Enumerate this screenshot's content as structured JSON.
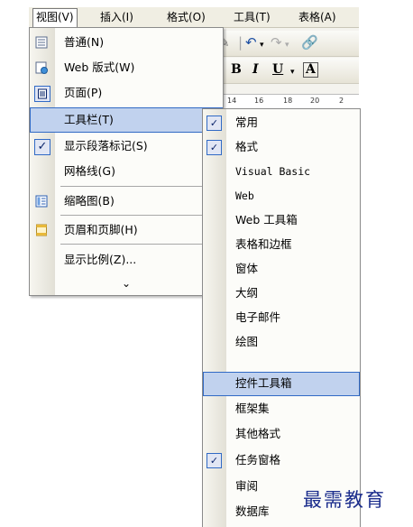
{
  "menubar": {
    "items": [
      {
        "label": "视图(V)",
        "active": true
      },
      {
        "label": "插入(I)"
      },
      {
        "label": "格式(O)"
      },
      {
        "label": "工具(T)"
      },
      {
        "label": "表格(A)"
      }
    ]
  },
  "toolbar": {
    "bold": "B",
    "italic": "I",
    "underline": "U",
    "font_color": "A",
    "ruler_ticks": [
      "14",
      "16",
      "18",
      "20",
      "2"
    ]
  },
  "view_menu": {
    "items": [
      {
        "label": "普通(N)",
        "icon": "normal-view-icon"
      },
      {
        "label": "Web 版式(W)",
        "icon": "web-layout-icon"
      },
      {
        "label": "页面(P)",
        "icon": "page-layout-icon"
      },
      {
        "label": "工具栏(T)",
        "submenu_arrow": "▶"
      },
      {
        "label": "显示段落标记(S)",
        "checked": true
      },
      {
        "label": "网格线(G)"
      },
      {
        "label": "缩略图(B)",
        "icon": "thumbnail-icon"
      },
      {
        "label": "页眉和页脚(H)",
        "icon": "header-footer-icon"
      },
      {
        "label": "显示比例(Z)..."
      }
    ],
    "more_glyph": "⌄"
  },
  "toolbars_submenu": {
    "items": [
      {
        "label": "常用",
        "checked": true
      },
      {
        "label": "格式",
        "checked": true
      },
      {
        "label": "Visual Basic"
      },
      {
        "label": "Web"
      },
      {
        "label": "Web 工具箱"
      },
      {
        "label": "表格和边框"
      },
      {
        "label": "窗体"
      },
      {
        "label": "大纲"
      },
      {
        "label": "电子邮件"
      },
      {
        "label": "绘图"
      },
      {
        "label": "控件工具箱",
        "highlighted": true
      },
      {
        "label": "框架集"
      },
      {
        "label": "其他格式"
      },
      {
        "label": "任务窗格",
        "checked": true
      },
      {
        "label": "审阅"
      },
      {
        "label": "数据库"
      }
    ]
  },
  "watermark": "最需教育",
  "colors": {
    "highlight": "#c1d2ee",
    "highlight_border": "#316ac5",
    "menu_bg": "#fcfcf9",
    "watermark": "#1a2c8c"
  }
}
